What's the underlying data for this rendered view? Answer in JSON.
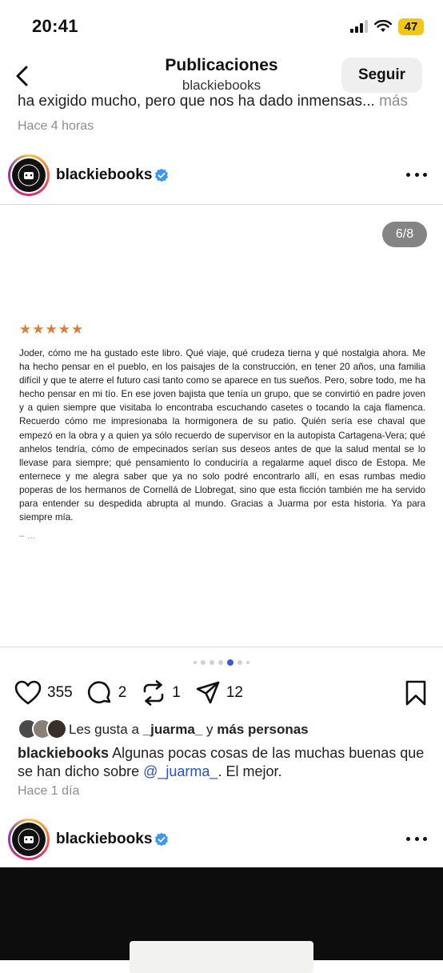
{
  "status_bar": {
    "time": "20:41",
    "battery": "47"
  },
  "header": {
    "title": "Publicaciones",
    "subtitle": "blackiebooks",
    "follow_label": "Seguir"
  },
  "previous_post": {
    "caption_tail": "ha exigido mucho, pero que nos ha dado inmensas...",
    "more": "más",
    "time": "Hace 4 horas"
  },
  "post": {
    "username": "blackiebooks",
    "counter": "6/8",
    "stars": "★★★★★",
    "review_text": "Joder, cómo me ha gustado este libro. Qué viaje, qué crudeza tierna y qué nostalgia ahora. Me ha hecho pensar en el pueblo, en los paisajes de la construcción, en tener 20 años, una familia difícil y que te aterre el futuro casi tanto como se aparece en tus sueños. Pero, sobre todo, me ha hecho pensar en mi tío. En ese joven bajista que tenía un grupo, que se convirtió en padre joven y a quien siempre que visitaba lo encontraba escuchando casetes o tocando la caja flamenca. Recuerdo cómo me impresionaba la hormigonera de su patio. Quién sería ese chaval que empezó en la obra y a quien ya sólo recuerdo de supervisor en la autopista Cartagena-Vera; qué anhelos tendría, cómo de empecinados serían sus deseos antes de que la salud mental se lo llevase para siempre; qué pensamiento lo conduciría a regalarme aquel disco de Estopa. Me enternece y me alegra saber que ya no solo podré encontrarlo allí, en esas rumbas medio poperas de los hermanos de Cornellá de Llobregat, sino que esta ficción también me ha servido para entender su despedida abrupta al mundo. Gracias a Juarma por esta historia. Ya para siempre mía.",
    "review_tail": "– ...",
    "carousel": {
      "current": 5,
      "total": 8
    },
    "likes": "355",
    "comments": "2",
    "reposts": "1",
    "shares": "12",
    "liked_by_prefix": "Les gusta a",
    "liked_by_user": "_juarma_",
    "liked_by_and": "y",
    "liked_by_more": "más personas",
    "caption_user": "blackiebooks",
    "caption_text": "Algunas pocas cosas de las muchas buenas que se han dicho sobre",
    "caption_mention": "@_juarma_",
    "caption_end": ". El mejor.",
    "time": "Hace 1 día"
  },
  "next_post": {
    "username": "blackiebooks"
  },
  "colors": {
    "verified": "#3897f0",
    "stars": "#e07b39",
    "mention": "#2c4fc6",
    "dot_active": "#3b5bd9",
    "battery": "#f2c718"
  },
  "icons": [
    "back-chevron-icon",
    "signal-icon",
    "wifi-icon",
    "verified-badge-icon",
    "more-options-icon",
    "heart-icon",
    "comment-icon",
    "repost-icon",
    "share-icon",
    "bookmark-icon"
  ]
}
